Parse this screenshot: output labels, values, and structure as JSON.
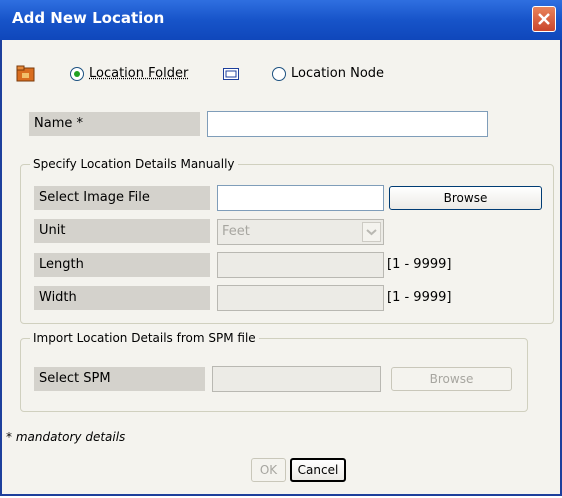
{
  "dialog": {
    "title": "Add New Location",
    "type_options": [
      {
        "label": "Location Folder",
        "selected": true
      },
      {
        "label": "Location Node",
        "selected": false
      }
    ],
    "name_label": "Name *",
    "name_value": ""
  },
  "manual": {
    "legend": "Specify Location Details Manually",
    "image_label": "Select Image File",
    "browse_label": "Browse",
    "unit_label": "Unit",
    "unit_value": "Feet",
    "length_label": "Length",
    "length_range": "[1 - 9999]",
    "width_label": "Width",
    "width_range": "[1 - 9999]"
  },
  "spm": {
    "legend": "Import Location Details from SPM file",
    "select_label": "Select SPM",
    "browse_label": "Browse"
  },
  "footer": {
    "note": "* mandatory details",
    "ok_label": "OK",
    "cancel_label": "Cancel"
  },
  "colors": {
    "titlebar": "#1754c9",
    "close": "#c9462d",
    "radio_dot": "#21a121",
    "label_bg": "#d4d2cc"
  }
}
